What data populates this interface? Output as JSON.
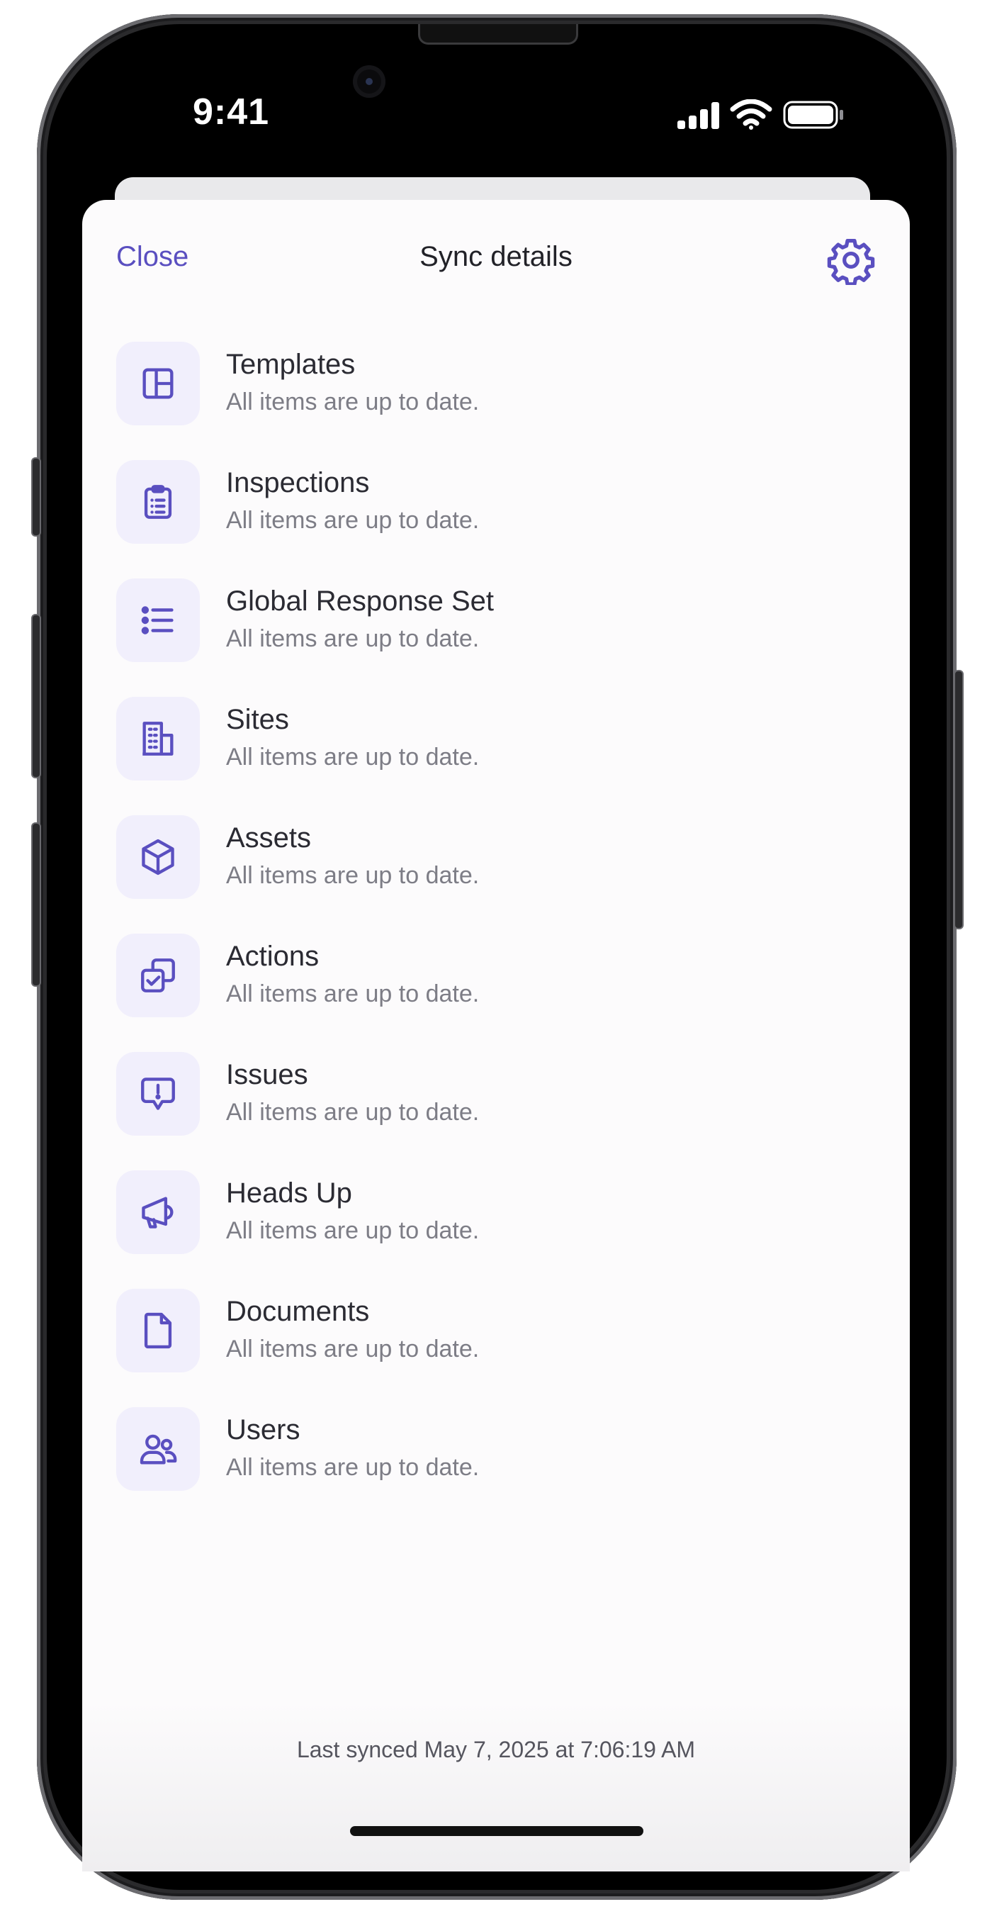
{
  "status_bar": {
    "time": "9:41",
    "signal_icon": "cellular-signal-icon",
    "wifi_icon": "wifi-icon",
    "battery_icon": "battery-icon"
  },
  "header": {
    "close_label": "Close",
    "title": "Sync details",
    "settings_icon": "gear-icon"
  },
  "colors": {
    "accent": "#5a4fc0",
    "icon_tile_bg": "#f1effc",
    "title_text": "#2b2b33",
    "subtitle_text": "#7d7d86"
  },
  "items": [
    {
      "title": "Templates",
      "status": "All items are up to date.",
      "icon": "layout-template-icon"
    },
    {
      "title": "Inspections",
      "status": "All items are up to date.",
      "icon": "clipboard-list-icon"
    },
    {
      "title": "Global Response Set",
      "status": "All items are up to date.",
      "icon": "bulleted-list-icon"
    },
    {
      "title": "Sites",
      "status": "All items are up to date.",
      "icon": "building-icon"
    },
    {
      "title": "Assets",
      "status": "All items are up to date.",
      "icon": "cube-icon"
    },
    {
      "title": "Actions",
      "status": "All items are up to date.",
      "icon": "checkbox-copy-icon"
    },
    {
      "title": "Issues",
      "status": "All items are up to date.",
      "icon": "alert-message-icon"
    },
    {
      "title": "Heads Up",
      "status": "All items are up to date.",
      "icon": "megaphone-icon"
    },
    {
      "title": "Documents",
      "status": "All items are up to date.",
      "icon": "document-icon"
    },
    {
      "title": "Users",
      "status": "All items are up to date.",
      "icon": "users-icon"
    }
  ],
  "footer": {
    "last_synced": "Last synced May 7, 2025 at 7:06:19 AM"
  }
}
